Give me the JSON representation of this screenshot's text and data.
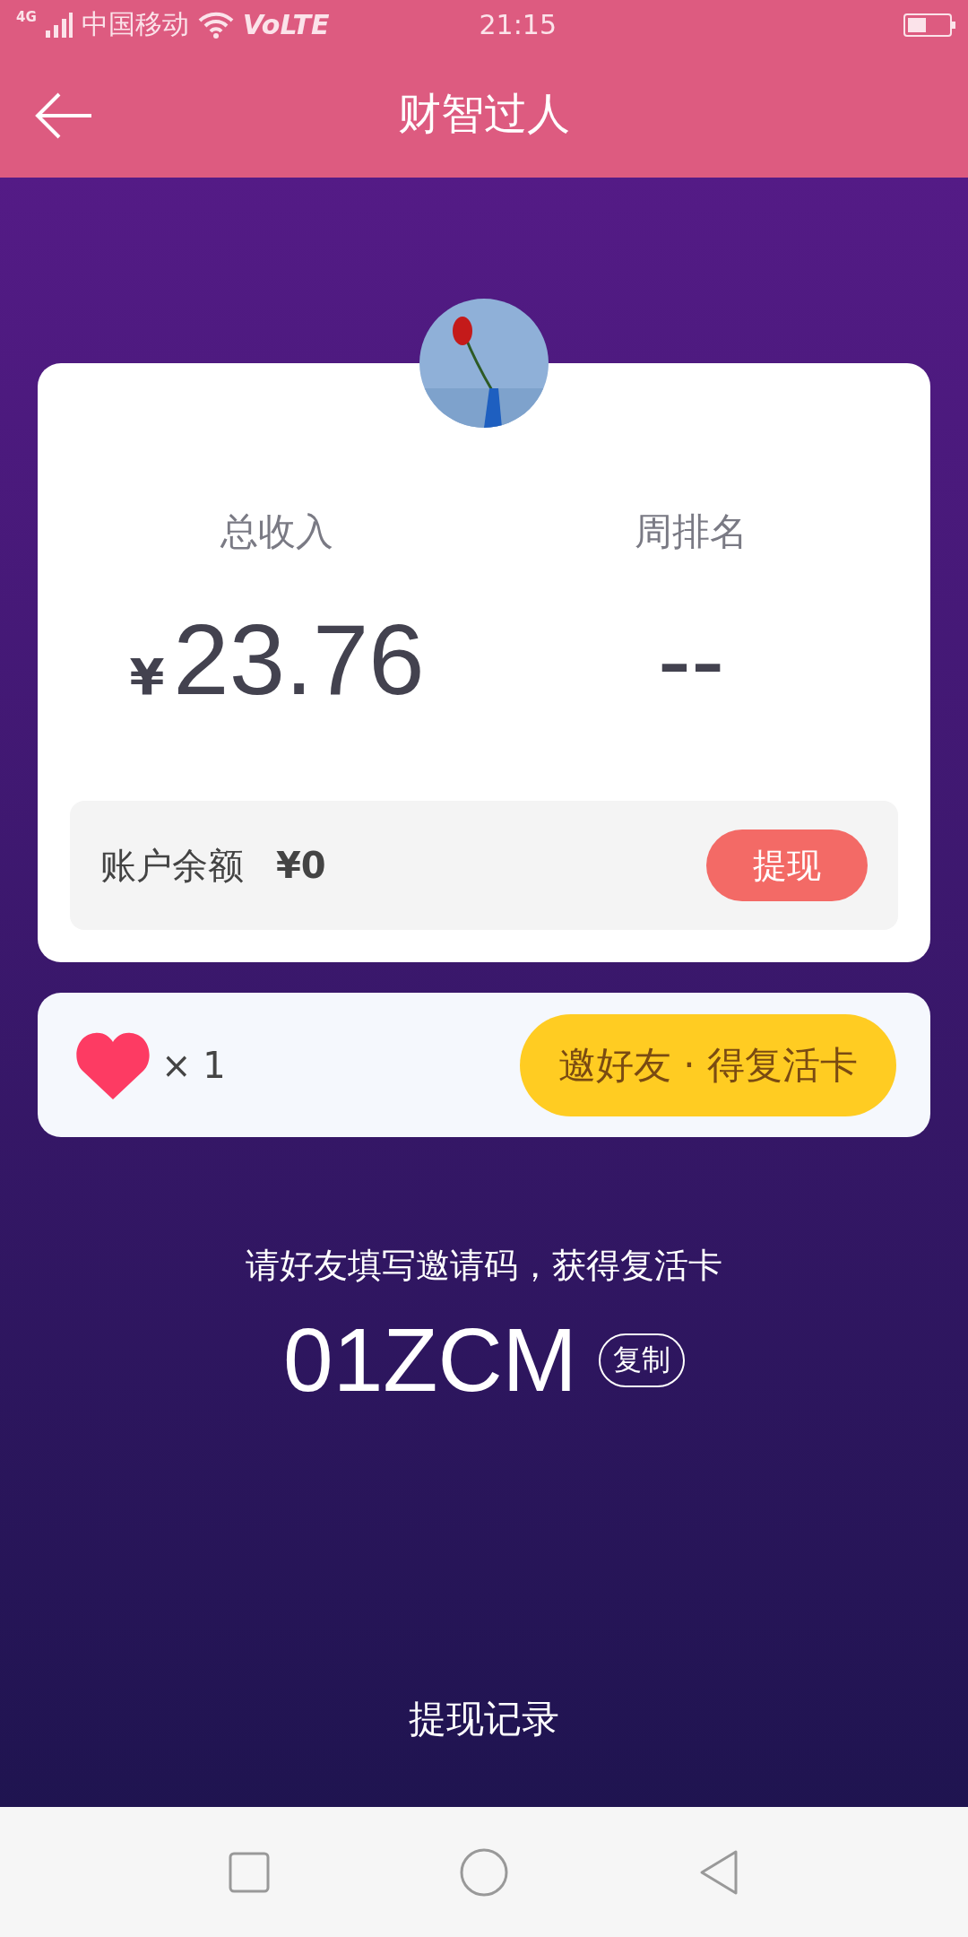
{
  "status_bar": {
    "network": "4G",
    "carrier": "中国移动",
    "volte": "VoLTE",
    "time": "21:15"
  },
  "header": {
    "title": "财智过人"
  },
  "stats": [
    {
      "label": "总收入",
      "currency": "¥",
      "value": "23.76"
    },
    {
      "label": "周排名",
      "value": "--"
    }
  ],
  "balance": {
    "label": "账户余额",
    "value": "¥0",
    "button": "提现"
  },
  "lives": {
    "count": "× 1",
    "button": "邀好友 · 得复活卡"
  },
  "invite": {
    "hint": "请好友填写邀请码，获得复活卡",
    "code": "01ZCM",
    "copy": "复制"
  },
  "footer_link": "提现记录"
}
